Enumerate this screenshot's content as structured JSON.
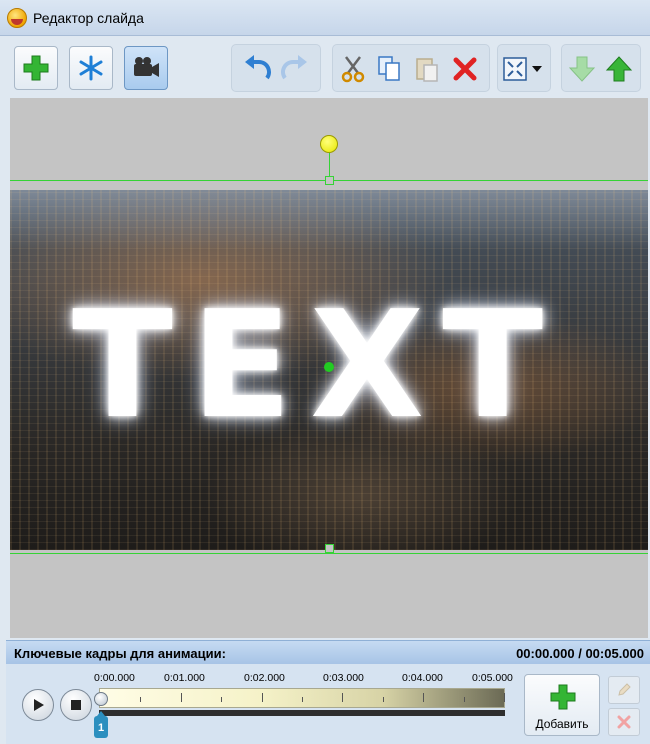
{
  "window": {
    "title": "Редактор слайда"
  },
  "toolbar": {
    "buttons": [
      {
        "name": "add",
        "icon": "green-plus-icon"
      },
      {
        "name": "effects",
        "icon": "snowflake-icon"
      },
      {
        "name": "camera",
        "icon": "camera-icon",
        "active": true
      },
      {
        "name": "undo",
        "icon": "undo-icon"
      },
      {
        "name": "redo",
        "icon": "redo-icon",
        "disabled": true
      },
      {
        "name": "cut",
        "icon": "scissors-icon"
      },
      {
        "name": "copy",
        "icon": "copy-icon"
      },
      {
        "name": "paste",
        "icon": "paste-icon",
        "disabled": true
      },
      {
        "name": "delete",
        "icon": "red-x-icon"
      },
      {
        "name": "fit",
        "icon": "fit-to-screen-icon"
      },
      {
        "name": "move-down",
        "icon": "green-arrow-down-icon",
        "disabled": true
      },
      {
        "name": "move-up",
        "icon": "green-arrow-up-icon"
      }
    ]
  },
  "canvas": {
    "overlay_text": "TEXT"
  },
  "keyframes": {
    "title": "Ключевые кадры для анимации:",
    "time": "00:00.000 / 00:05.000",
    "tick_labels": [
      "0:00.000",
      "0:01.000",
      "0:02.000",
      "0:03.000",
      "0:04.000",
      "0:05.000"
    ],
    "marker": "1",
    "add_label": "Добавить"
  },
  "colors": {
    "guide": "#35d335",
    "accent_green": "#2eae2e",
    "accent_blue": "#2c8fbf"
  }
}
